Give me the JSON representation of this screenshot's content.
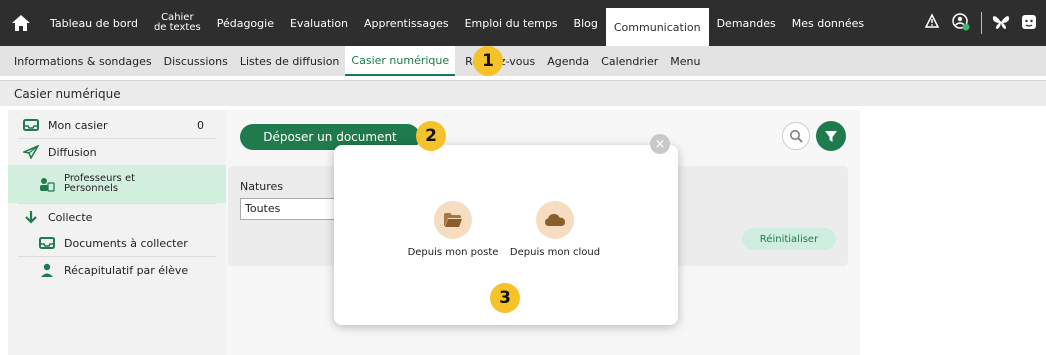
{
  "top_nav": {
    "items": [
      {
        "label": "Tableau de bord"
      },
      {
        "label": "Cahier"
      },
      {
        "label": "Pédagogie"
      },
      {
        "label": "Evaluation"
      },
      {
        "label": "Apprentissages"
      },
      {
        "label": "Emploi du temps"
      },
      {
        "label": "Blog"
      },
      {
        "label": "Communication"
      },
      {
        "label": "Demandes"
      },
      {
        "label": "Mes données"
      }
    ],
    "cahier_line2": "de textes",
    "active": "Communication"
  },
  "sub_nav": {
    "items": [
      {
        "label": "Informations & sondages"
      },
      {
        "label": "Discussions"
      },
      {
        "label": "Listes de diffusion"
      },
      {
        "label": "Casier numérique"
      },
      {
        "label": "Rendez-vous"
      },
      {
        "label": "Agenda"
      },
      {
        "label": "Calendrier"
      },
      {
        "label": "Menu"
      }
    ],
    "active": "Casier numérique"
  },
  "breadcrumb": "Casier numérique",
  "sidebar": {
    "mon_casier": {
      "label": "Mon casier",
      "count": "0"
    },
    "diffusion": {
      "label": "Diffusion"
    },
    "profs_line1": "Professeurs et",
    "profs_line2": "Personnels",
    "collecte": {
      "label": "Collecte"
    },
    "documents": {
      "label": "Documents à collecter"
    },
    "recap": {
      "label": "Récapitulatif par élève"
    }
  },
  "main": {
    "deposit_label": "Déposer un document",
    "filter": {
      "natures_label": "Natures",
      "natures_value": "Toutes",
      "reset_label": "Réinitialiser"
    }
  },
  "modal": {
    "close": "×",
    "options": [
      {
        "label": "Depuis mon poste",
        "icon": "folder-icon"
      },
      {
        "label": "Depuis mon cloud",
        "icon": "cloud-icon"
      }
    ]
  },
  "badges": [
    "1",
    "2",
    "3"
  ],
  "colors": {
    "topbar": "#2e2e2e",
    "accent": "#1f7a4d",
    "badge": "#f6c22a",
    "option_circle": "#f6dcc0"
  }
}
